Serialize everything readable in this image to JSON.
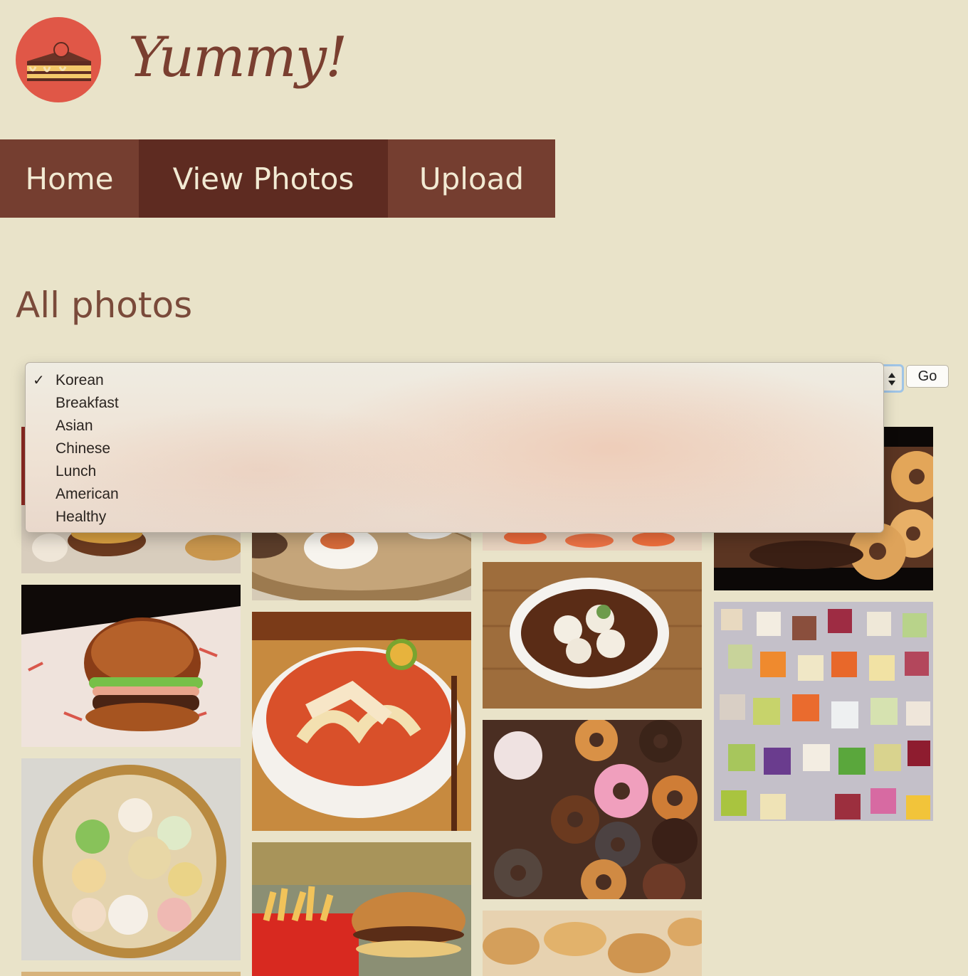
{
  "header": {
    "brand": "Yummy!",
    "logo_icon": "cake-slice-icon"
  },
  "nav": {
    "items": [
      {
        "label": "Home",
        "active": false
      },
      {
        "label": "View Photos",
        "active": true
      },
      {
        "label": "Upload",
        "active": false
      }
    ]
  },
  "page": {
    "title": "All photos"
  },
  "filter": {
    "selected": "Korean",
    "options": [
      "Korean",
      "Breakfast",
      "Asian",
      "Chinese",
      "Lunch",
      "American",
      "Healthy"
    ],
    "check_mark": "✓",
    "go_label": "Go"
  },
  "photos": [
    {
      "subject": "burger and fries platter"
    },
    {
      "subject": "deviled eggs on wooden board"
    },
    {
      "subject": "shrimp dish"
    },
    {
      "subject": "glazed donuts"
    },
    {
      "subject": "sesame bun burger"
    },
    {
      "subject": "curry laksa noodle soup"
    },
    {
      "subject": "dumplings in sauce"
    },
    {
      "subject": "vegetable cubes"
    },
    {
      "subject": "dim sum steamer basket"
    },
    {
      "subject": "burger and fries"
    },
    {
      "subject": "assorted donuts"
    },
    {
      "subject": "fried pastries"
    }
  ]
}
